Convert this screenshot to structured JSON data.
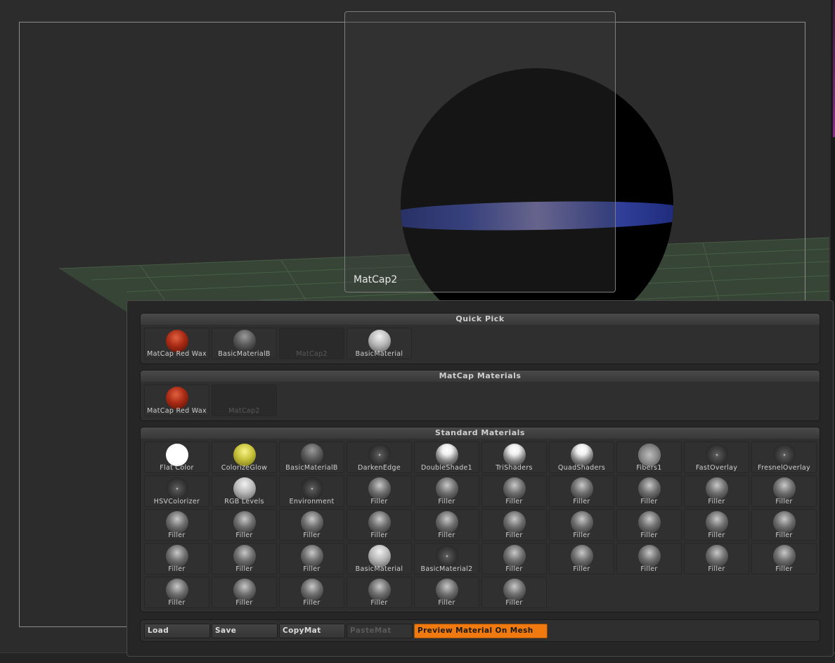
{
  "preview": {
    "label": "MatCap2"
  },
  "sections": {
    "quick_pick": {
      "title": "Quick Pick",
      "items": [
        {
          "label": "MatCap Red Wax",
          "ball": "red"
        },
        {
          "label": "BasicMaterialB",
          "ball": "gray"
        },
        {
          "label": "MatCap2",
          "ball": "none",
          "dim": true
        },
        {
          "label": "BasicMaterial",
          "ball": "light"
        }
      ]
    },
    "matcap": {
      "title": "MatCap Materials",
      "items": [
        {
          "label": "MatCap Red Wax",
          "ball": "red"
        },
        {
          "label": "MatCap2",
          "ball": "none",
          "dim": true
        }
      ]
    },
    "standard": {
      "title": "Standard Materials",
      "items": [
        {
          "label": "Flat Color",
          "ball": "white"
        },
        {
          "label": "ColorizeGlow",
          "ball": "yellow"
        },
        {
          "label": "BasicMaterialB",
          "ball": "gray"
        },
        {
          "label": "DarkenEdge",
          "ball": "dark"
        },
        {
          "label": "DoubleShade1",
          "ball": "shiny"
        },
        {
          "label": "TriShaders",
          "ball": "shiny"
        },
        {
          "label": "QuadShaders",
          "ball": "shiny"
        },
        {
          "label": "Fibers1",
          "ball": "fibers"
        },
        {
          "label": "FastOverlay",
          "ball": "dark"
        },
        {
          "label": "FresnelOverlay",
          "ball": "dark"
        },
        {
          "label": "HSVColorizer",
          "ball": "dark"
        },
        {
          "label": "RGB Levels",
          "ball": "light"
        },
        {
          "label": "Environment",
          "ball": "dark"
        },
        {
          "label": "Filler",
          "ball": "filler"
        },
        {
          "label": "Filler",
          "ball": "filler"
        },
        {
          "label": "Filler",
          "ball": "filler"
        },
        {
          "label": "Filler",
          "ball": "filler"
        },
        {
          "label": "Filler",
          "ball": "filler"
        },
        {
          "label": "Filler",
          "ball": "filler"
        },
        {
          "label": "Filler",
          "ball": "filler"
        },
        {
          "label": "Filler",
          "ball": "filler"
        },
        {
          "label": "Filler",
          "ball": "filler"
        },
        {
          "label": "Filler",
          "ball": "filler"
        },
        {
          "label": "Filler",
          "ball": "filler"
        },
        {
          "label": "Filler",
          "ball": "filler"
        },
        {
          "label": "Filler",
          "ball": "filler"
        },
        {
          "label": "Filler",
          "ball": "filler"
        },
        {
          "label": "Filler",
          "ball": "filler"
        },
        {
          "label": "Filler",
          "ball": "filler"
        },
        {
          "label": "Filler",
          "ball": "filler"
        },
        {
          "label": "Filler",
          "ball": "filler"
        },
        {
          "label": "Filler",
          "ball": "filler"
        },
        {
          "label": "Filler",
          "ball": "filler"
        },
        {
          "label": "BasicMaterial",
          "ball": "light"
        },
        {
          "label": "BasicMaterial2",
          "ball": "dark"
        },
        {
          "label": "Filler",
          "ball": "filler"
        },
        {
          "label": "Filler",
          "ball": "filler"
        },
        {
          "label": "Filler",
          "ball": "filler"
        },
        {
          "label": "Filler",
          "ball": "filler"
        },
        {
          "label": "Filler",
          "ball": "filler"
        },
        {
          "label": "Filler",
          "ball": "filler"
        },
        {
          "label": "Filler",
          "ball": "filler"
        },
        {
          "label": "Filler",
          "ball": "filler"
        },
        {
          "label": "Filler",
          "ball": "filler"
        },
        {
          "label": "Filler",
          "ball": "filler"
        },
        {
          "label": "Filler",
          "ball": "filler"
        }
      ]
    }
  },
  "buttons": {
    "load": "Load",
    "save": "Save",
    "copymat": "CopyMat",
    "pastemat": "PasteMat",
    "preview_on_mesh": "Preview Material On Mesh"
  },
  "colors": {
    "accent": "#f07a10",
    "grid": "#3f5a3f"
  }
}
